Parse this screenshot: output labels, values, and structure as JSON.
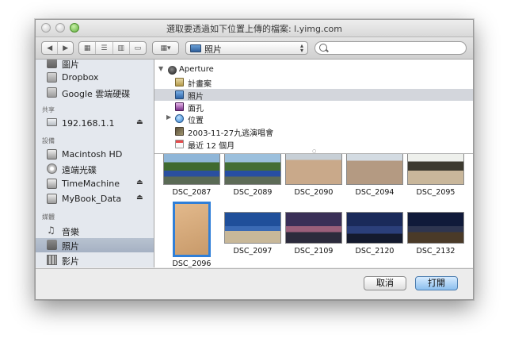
{
  "window": {
    "title": "選取要透過如下位置上傳的檔案: l.yimg.com"
  },
  "toolbar": {
    "back_icon": "back-arrow-icon",
    "forward_icon": "forward-arrow-icon",
    "location": "照片",
    "search_placeholder": ""
  },
  "sidebar": {
    "items_top": [
      {
        "label": "圖片",
        "icon": "camera-icon"
      },
      {
        "label": "Dropbox",
        "icon": "folder-icon"
      },
      {
        "label": "Google 雲端硬碟",
        "icon": "folder-icon"
      }
    ],
    "shared_heading": "共享",
    "shared": [
      {
        "label": "192.168.1.1",
        "icon": "monitor-icon"
      }
    ],
    "devices_heading": "設備",
    "devices": [
      {
        "label": "Macintosh HD",
        "icon": "disk-icon"
      },
      {
        "label": "遠端光碟",
        "icon": "cd-icon"
      },
      {
        "label": "TimeMachine",
        "icon": "disk-icon"
      },
      {
        "label": "MyBook_Data",
        "icon": "disk-icon"
      }
    ],
    "media_heading": "媒體",
    "media": [
      {
        "label": "音樂",
        "icon": "music-icon"
      },
      {
        "label": "照片",
        "icon": "camera-icon",
        "selected": true
      },
      {
        "label": "影片",
        "icon": "film-icon"
      }
    ]
  },
  "browser": {
    "items": [
      {
        "label": "Aperture",
        "icon": "aperture-icon",
        "expanded": true
      },
      {
        "label": "計畫案",
        "icon": "project-icon"
      },
      {
        "label": "照片",
        "icon": "photos-icon",
        "selected": true
      },
      {
        "label": "面孔",
        "icon": "faces-icon"
      },
      {
        "label": "位置",
        "icon": "globe-icon"
      },
      {
        "label": "2003-11-27九逃演唱會",
        "icon": "event-icon"
      },
      {
        "label": "最近 12 個月",
        "icon": "calendar-icon"
      }
    ]
  },
  "photos": [
    {
      "name": "DSC_2087"
    },
    {
      "name": "DSC_2089"
    },
    {
      "name": "DSC_2090"
    },
    {
      "name": "DSC_2094"
    },
    {
      "name": "DSC_2095"
    },
    {
      "name": "DSC_2096",
      "selected": true
    },
    {
      "name": "DSC_2097"
    },
    {
      "name": "DSC_2109"
    },
    {
      "name": "DSC_2120"
    },
    {
      "name": "DSC_2132"
    }
  ],
  "buttons": {
    "cancel": "取消",
    "open": "打開"
  }
}
